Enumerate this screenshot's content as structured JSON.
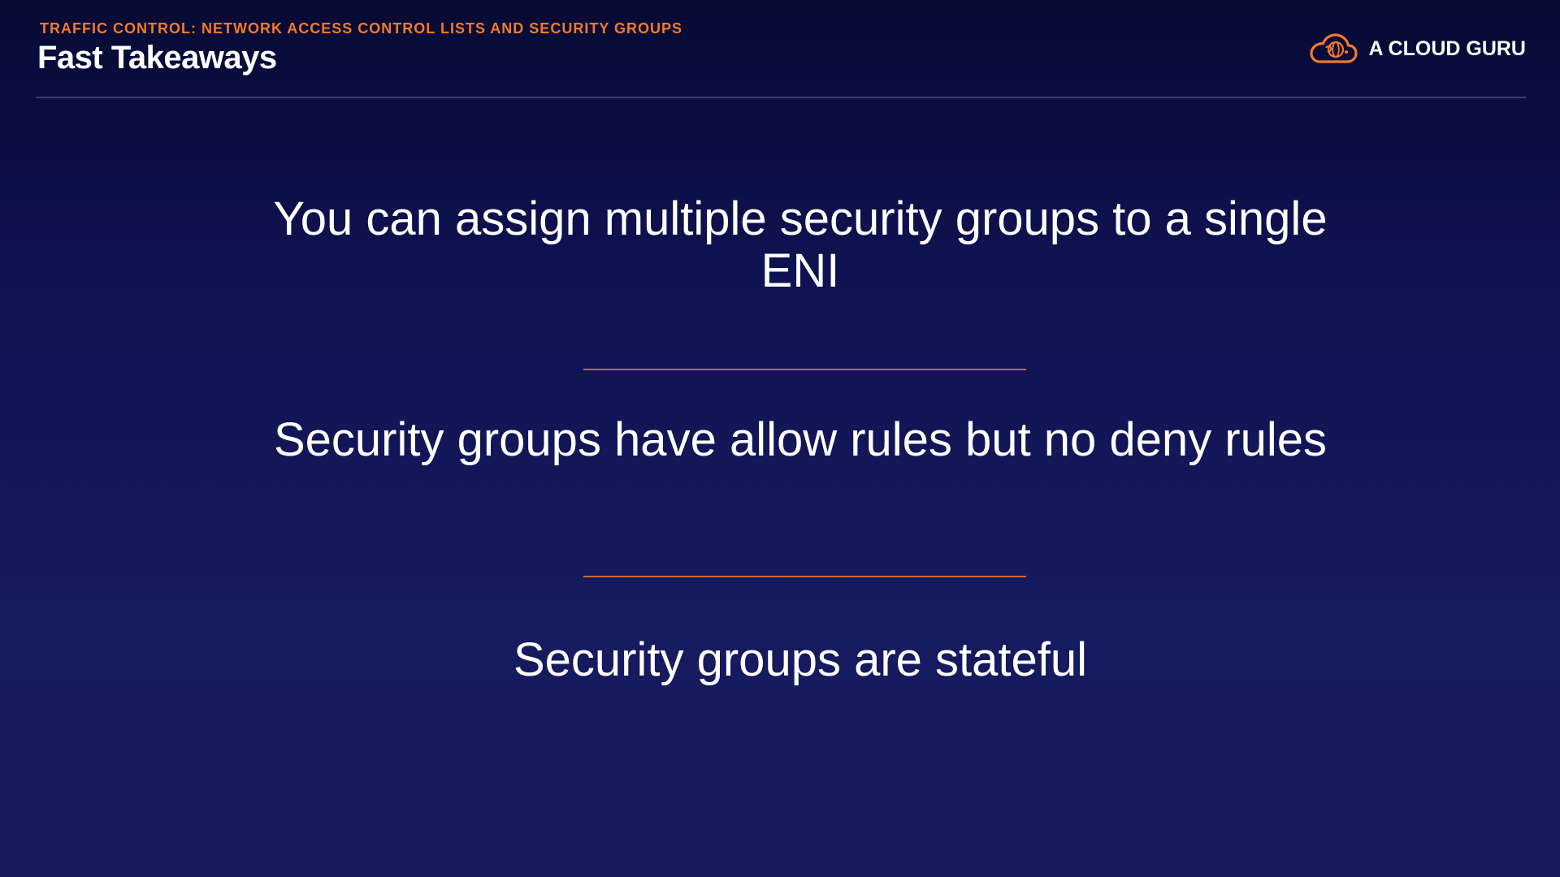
{
  "header": {
    "kicker": "TRAFFIC CONTROL: NETWORK ACCESS CONTROL LISTS AND SECURITY GROUPS",
    "title": "Fast Takeaways"
  },
  "brand": {
    "name": "A CLOUD GURU",
    "logo_icon": "cloud-logo-icon",
    "accent_color": "#f5792a"
  },
  "takeaways": [
    {
      "text": "You can assign multiple security groups to a single ENI"
    },
    {
      "text": "Security groups have allow rules but no deny rules"
    },
    {
      "text": "Security groups are stateful"
    }
  ],
  "colors": {
    "background_top": "#060a33",
    "background_bottom": "#16195c",
    "divider": "#c4692f"
  }
}
